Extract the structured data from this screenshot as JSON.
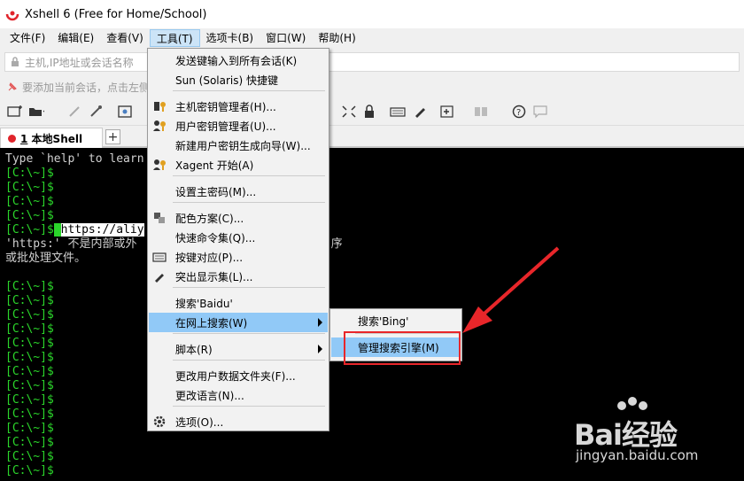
{
  "window": {
    "title": "Xshell 6 (Free for Home/School)"
  },
  "menubar": [
    {
      "label": "文件(F)"
    },
    {
      "label": "编辑(E)"
    },
    {
      "label": "查看(V)"
    },
    {
      "label": "工具(T)",
      "active": true
    },
    {
      "label": "选项卡(B)"
    },
    {
      "label": "窗口(W)"
    },
    {
      "label": "帮助(H)"
    }
  ],
  "addressbar": {
    "placeholder": "主机,IP地址或会话名称"
  },
  "hintbar": {
    "text": "要添加当前会话，点击左侧"
  },
  "tabs": [
    {
      "number": "1",
      "label": "本地Shell"
    }
  ],
  "terminal": {
    "lines": [
      {
        "prompt": "",
        "text": "Type `help' to learn"
      },
      {
        "prompt": "[C:\\~]$",
        "text": ""
      },
      {
        "prompt": "[C:\\~]$",
        "text": ""
      },
      {
        "prompt": "[C:\\~]$",
        "text": ""
      },
      {
        "prompt": "[C:\\~]$",
        "text": ""
      },
      {
        "prompt": "[C:\\~]$",
        "text": "https://aliy",
        "selected": true
      },
      {
        "prompt": "",
        "text": "'https:' 不是内部或外                            序"
      },
      {
        "prompt": "",
        "text": "或批处理文件。"
      },
      {
        "prompt": "",
        "text": ""
      },
      {
        "prompt": "[C:\\~]$",
        "text": ""
      },
      {
        "prompt": "[C:\\~]$",
        "text": ""
      },
      {
        "prompt": "[C:\\~]$",
        "text": ""
      },
      {
        "prompt": "[C:\\~]$",
        "text": ""
      },
      {
        "prompt": "[C:\\~]$",
        "text": ""
      },
      {
        "prompt": "[C:\\~]$",
        "text": ""
      },
      {
        "prompt": "[C:\\~]$",
        "text": ""
      },
      {
        "prompt": "[C:\\~]$",
        "text": ""
      },
      {
        "prompt": "[C:\\~]$",
        "text": ""
      },
      {
        "prompt": "[C:\\~]$",
        "text": ""
      },
      {
        "prompt": "[C:\\~]$",
        "text": ""
      },
      {
        "prompt": "[C:\\~]$",
        "text": ""
      },
      {
        "prompt": "[C:\\~]$",
        "text": ""
      },
      {
        "prompt": "[C:\\~]$",
        "text": ""
      }
    ]
  },
  "tools_menu": {
    "items": [
      {
        "label": "发送键输入到所有会话(K)",
        "icon": ""
      },
      {
        "label": "Sun (Solaris) 快捷键",
        "icon": ""
      },
      {
        "label": "主机密钥管理者(H)...",
        "icon": "host-key-icon"
      },
      {
        "label": "用户密钥管理者(U)...",
        "icon": "user-key-icon"
      },
      {
        "label": "新建用户密钥生成向导(W)...",
        "icon": ""
      },
      {
        "label": "Xagent 开始(A)",
        "icon": "xagent-icon"
      },
      {
        "label": "设置主密码(M)...",
        "icon": ""
      },
      {
        "label": "配色方案(C)...",
        "icon": "color-scheme-icon"
      },
      {
        "label": "快速命令集(Q)...",
        "icon": ""
      },
      {
        "label": "按键对应(P)...",
        "icon": "keyboard-icon"
      },
      {
        "label": "突出显示集(L)...",
        "icon": "highlight-icon"
      },
      {
        "label": "搜索'Baidu'",
        "icon": ""
      },
      {
        "label": "在网上搜索(W)",
        "icon": "",
        "submenu": true,
        "highlighted": true
      },
      {
        "label": "脚本(R)",
        "icon": "",
        "submenu": true
      },
      {
        "label": "更改用户数据文件夹(F)...",
        "icon": ""
      },
      {
        "label": "更改语言(N)...",
        "icon": ""
      },
      {
        "label": "选项(O)...",
        "icon": "gear-icon"
      }
    ]
  },
  "search_submenu": {
    "items": [
      {
        "label": "搜索'Bing'"
      },
      {
        "label": "管理搜索引擎(M)",
        "highlighted": true
      }
    ]
  },
  "watermark": {
    "brand": "Bai经验",
    "url": "jingyan.baidu.com"
  },
  "colors": {
    "prompt_green": "#2bd62b",
    "menu_highlight": "#91c9f7",
    "annotation_red": "#e8262a",
    "tab_dot_red": "#e0242b"
  }
}
